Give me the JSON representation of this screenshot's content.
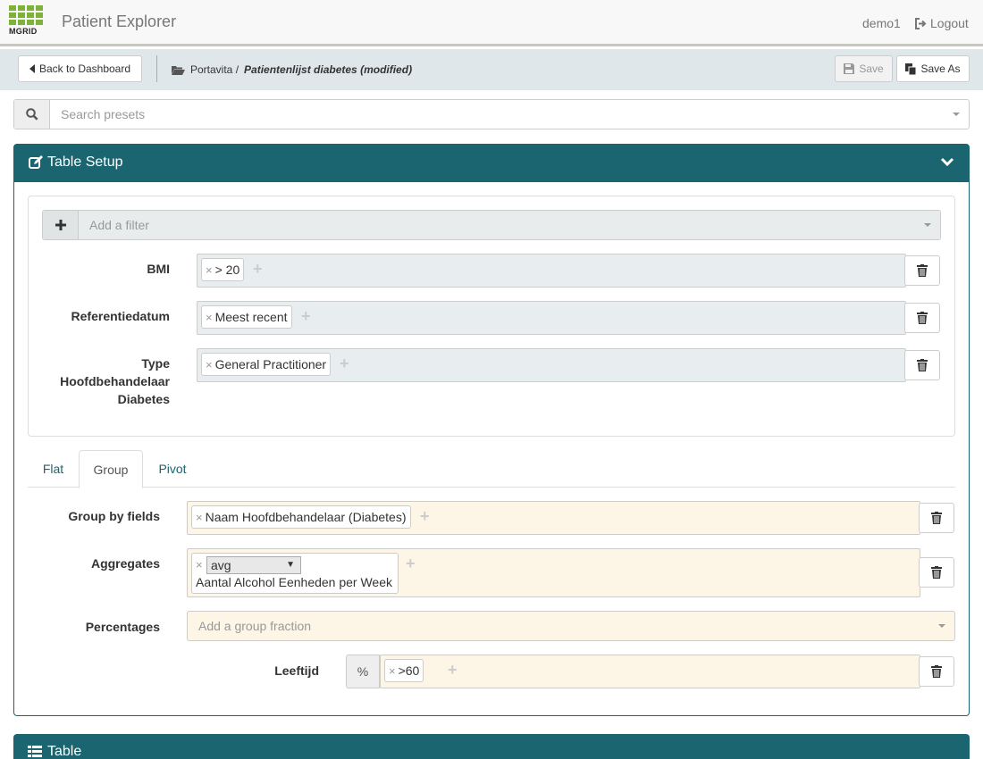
{
  "app": {
    "logo_text": "MGRID",
    "title": "Patient Explorer"
  },
  "nav": {
    "user": "demo1",
    "logout_label": "Logout"
  },
  "toolbar": {
    "back_label": "Back to Dashboard",
    "breadcrumb_parent": "Portavita /",
    "breadcrumb_current": "Patientenlijst diabetes (modified)",
    "save_label": "Save",
    "save_as_label": "Save As"
  },
  "search": {
    "placeholder": "Search presets"
  },
  "table_setup": {
    "title": "Table Setup",
    "add_filter_placeholder": "Add a filter",
    "filters": [
      {
        "label": "BMI",
        "tags": [
          "> 20"
        ]
      },
      {
        "label": "Referentiedatum",
        "tags": [
          "Meest recent"
        ]
      },
      {
        "label_lines": [
          "Type",
          "Hoofdbehandelaar",
          "Diabetes"
        ],
        "tags": [
          "General Practitioner"
        ]
      }
    ],
    "tabs": [
      {
        "label": "Flat",
        "active": false
      },
      {
        "label": "Group",
        "active": true
      },
      {
        "label": "Pivot",
        "active": false
      }
    ],
    "group_by": {
      "label": "Group by fields",
      "tags": [
        "Naam Hoofdbehandelaar (Diabetes)"
      ]
    },
    "aggregates": {
      "label": "Aggregates",
      "function": "avg",
      "field": "Aantal Alcohol Eenheden per Week"
    },
    "percentages": {
      "label": "Percentages",
      "placeholder": "Add a group fraction"
    },
    "leeftijd": {
      "label": "Leeftijd",
      "addon": "%",
      "tags": [
        ">60"
      ]
    }
  },
  "table_panel": {
    "title": "Table"
  },
  "colors": {
    "brand": "#1a6570",
    "logo_green": "#7fb239",
    "group_bg": "#fdf5e6",
    "filter_bg": "#e8edef"
  },
  "icons": [
    "search-icon",
    "edit-icon",
    "chevron-down-icon",
    "plus-icon",
    "trash-icon",
    "folder-icon",
    "save-icon",
    "copy-icon",
    "logout-icon",
    "list-icon",
    "caret-left-icon"
  ]
}
